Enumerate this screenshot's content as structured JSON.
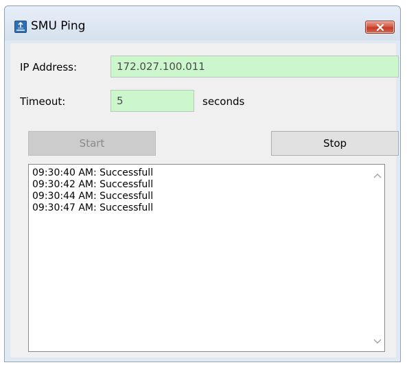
{
  "window": {
    "title": "SMU Ping",
    "app_icon": "network-app-icon",
    "close_icon": "close-icon"
  },
  "form": {
    "ip_label": "IP Address:",
    "ip_value": "172.027.100.011",
    "timeout_label": "Timeout:",
    "timeout_value": "5",
    "timeout_unit": "seconds"
  },
  "buttons": {
    "start_label": "Start",
    "start_enabled": false,
    "stop_label": "Stop"
  },
  "log": {
    "lines": [
      "09:30:40 AM: Successfull",
      "09:30:42 AM: Successfull",
      "09:30:44 AM: Successfull",
      "09:30:47 AM: Successfull"
    ]
  },
  "colors": {
    "field_bg": "#ccf7cc",
    "close_button": "#c23a26",
    "window_frame": "#dfe8f3"
  }
}
